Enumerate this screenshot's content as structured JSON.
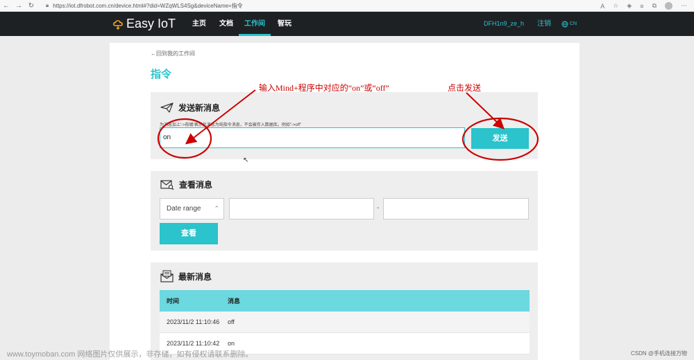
{
  "browser": {
    "url": "https://iot.dfrobot.com.cn/device.html#?did=WZqWLS4Sg&deviceName=指令"
  },
  "nav": {
    "logo": "Easy IoT",
    "links": [
      "主页",
      "文档",
      "工作间",
      "智玩"
    ],
    "device_name": "DFH1n9_ze_h",
    "logout": "注销",
    "lang": "CN"
  },
  "page": {
    "back_link": "←回到我的工作间",
    "title": "指令"
  },
  "send_panel": {
    "heading": "发送新消息",
    "hint": "为消息加上'->前缀'表示此消息为纯指令消息，不会被存入数据库。例如\"->off\"",
    "input_value": "on",
    "send_label": "发送"
  },
  "view_panel": {
    "heading": "查看消息",
    "date_range": "Date range",
    "separator": "-",
    "query_label": "查看"
  },
  "latest_panel": {
    "heading": "最新消息",
    "columns": [
      "时间",
      "消息"
    ],
    "rows": [
      {
        "time": "2023/11/2 11:10:46",
        "msg": "off"
      },
      {
        "time": "2023/11/2 11:10:42",
        "msg": "on"
      }
    ]
  },
  "annotations": {
    "input_note": "输入Mind+程序中对应的“on”或“off”",
    "send_note": "点击发送",
    "color": "#cc0000"
  },
  "watermark": "www.toymoban.com 网络图片仅供展示，非存储，如有侵权请联系删除。",
  "footer_credit": "CSDN @手机连接万物"
}
